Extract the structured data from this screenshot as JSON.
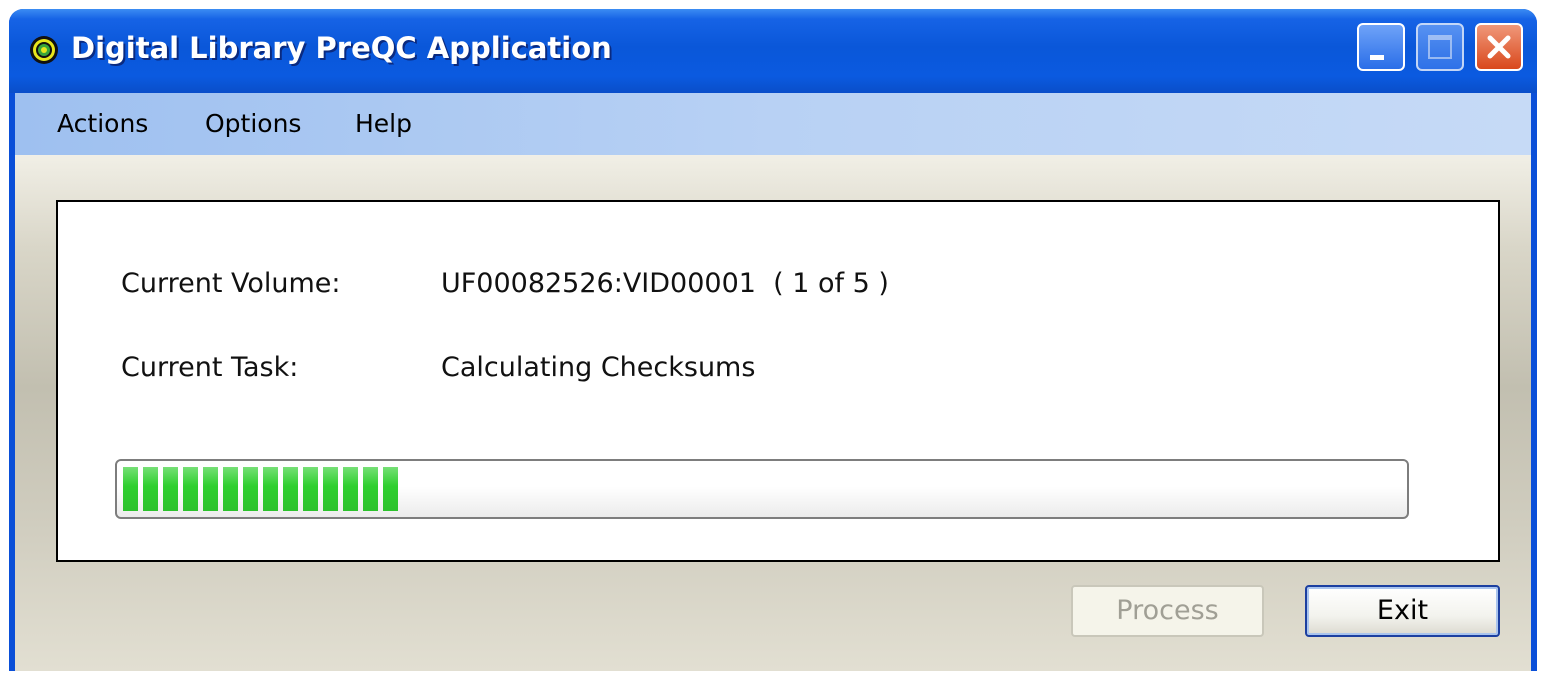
{
  "window": {
    "title": "Digital Library PreQC Application",
    "app_icon": "target-icon",
    "controls": [
      "minimize-icon",
      "maximize-icon",
      "close-icon"
    ],
    "maximize_enabled": false
  },
  "menu": {
    "items": [
      {
        "label": "Actions"
      },
      {
        "label": "Options"
      },
      {
        "label": "Help"
      }
    ]
  },
  "status": {
    "volume_label": "Current Volume:",
    "volume_value": "UF00082526:VID00001  ( 1 of 5 )",
    "task_label": "Current Task:",
    "task_value": "Calculating Checksums"
  },
  "progress": {
    "fraction": 0.22,
    "color": "#2fcf2f"
  },
  "buttons": {
    "process": {
      "label": "Process",
      "enabled": false
    },
    "exit": {
      "label": "Exit",
      "enabled": true
    }
  },
  "colors": {
    "titlebar": "#0a57d9",
    "menubar": "#b8d1f4",
    "panel": "#ffffff",
    "progress_green": "#2fcf2f",
    "close_button": "#d9481c"
  }
}
